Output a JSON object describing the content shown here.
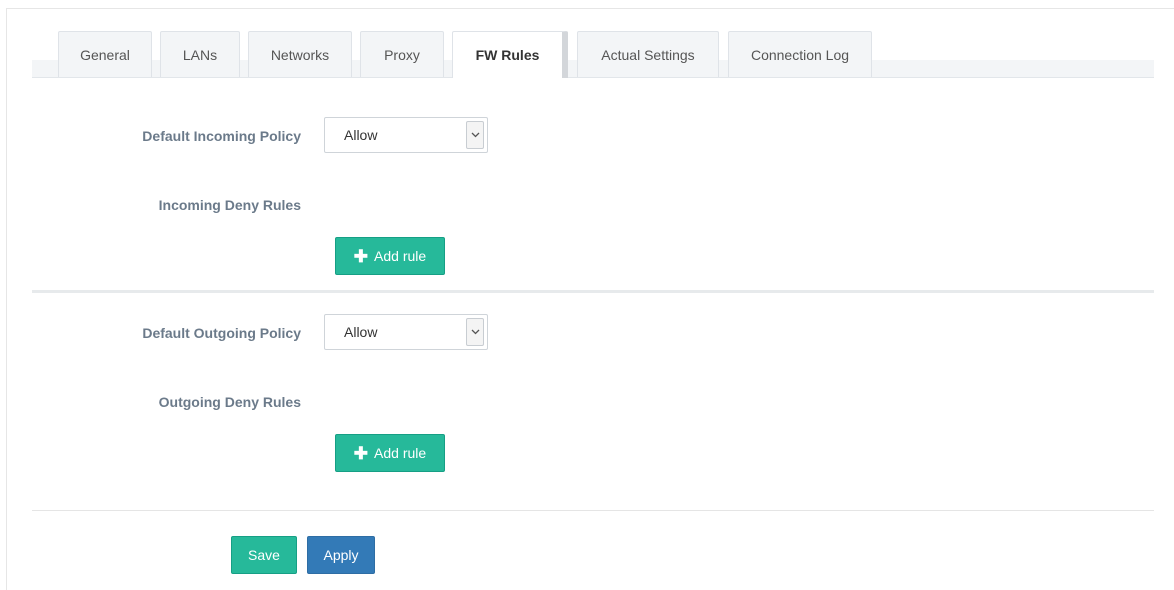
{
  "tabs": [
    {
      "label": "General"
    },
    {
      "label": "LANs"
    },
    {
      "label": "Networks"
    },
    {
      "label": "Proxy"
    },
    {
      "label": "FW Rules",
      "active": true
    },
    {
      "label": "Actual Settings"
    },
    {
      "label": "Connection Log"
    }
  ],
  "incoming": {
    "policy_label": "Default Incoming Policy",
    "policy_value": "Allow",
    "rules_label": "Incoming Deny Rules",
    "add_rule_label": "Add rule"
  },
  "outgoing": {
    "policy_label": "Default Outgoing Policy",
    "policy_value": "Allow",
    "rules_label": "Outgoing Deny Rules",
    "add_rule_label": "Add rule"
  },
  "actions": {
    "save_label": "Save",
    "apply_label": "Apply"
  },
  "colors": {
    "success": "#26b99a",
    "primary": "#337ab7",
    "label": "#6b7a8a"
  }
}
